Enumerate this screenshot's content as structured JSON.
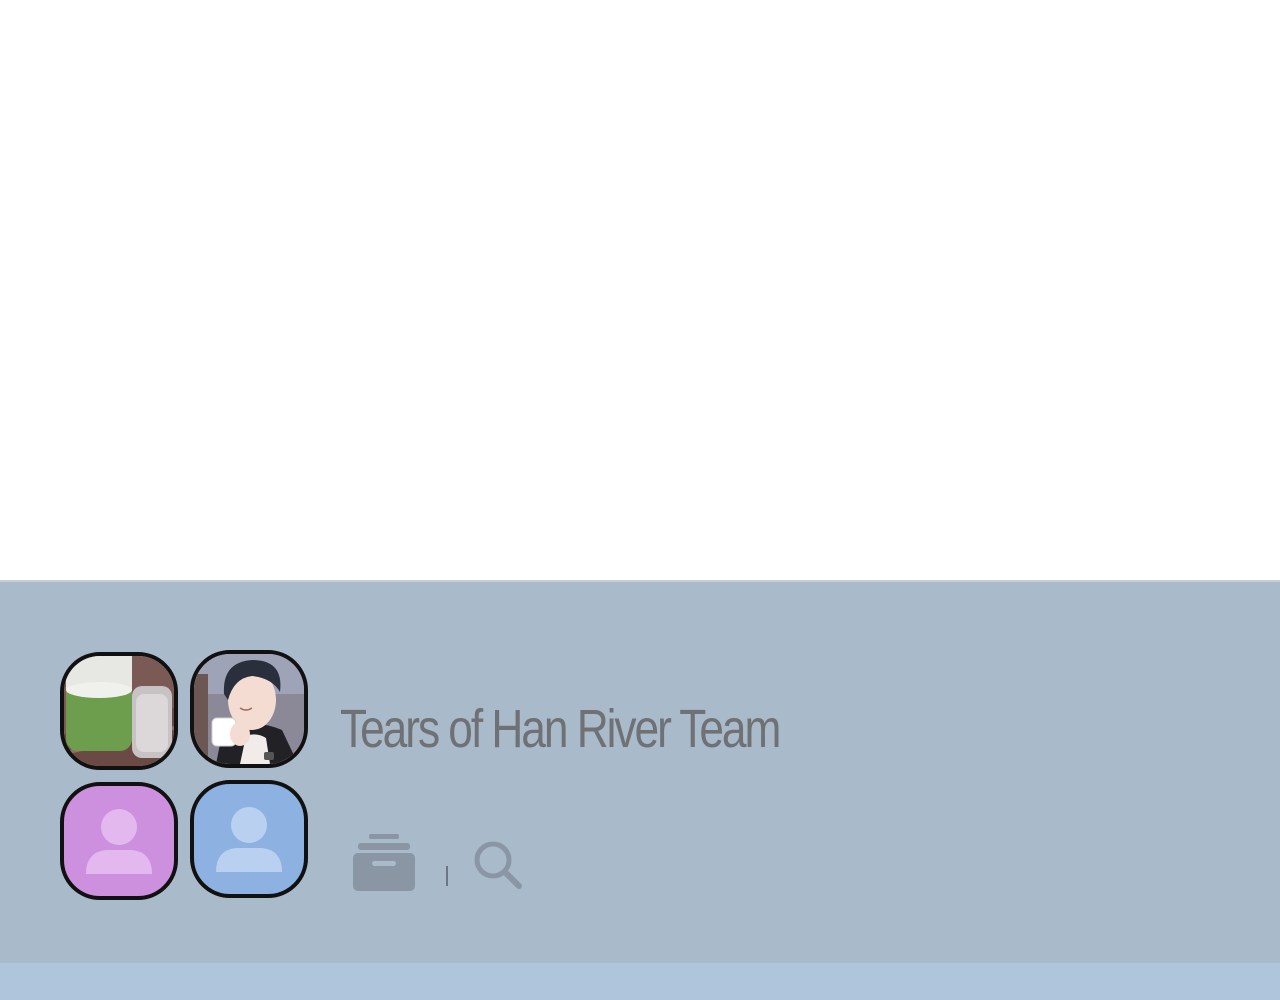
{
  "chat": {
    "title": "Tears of Han River Team"
  },
  "avatars": [
    {
      "kind": "photo",
      "subject": "drinks-on-table"
    },
    {
      "kind": "photo",
      "subject": "man-with-cup"
    },
    {
      "kind": "placeholder",
      "color": "#cd90de"
    },
    {
      "kind": "placeholder",
      "color": "#8db1e0"
    }
  ],
  "actions": [
    {
      "icon": "archive-icon"
    },
    {
      "icon": "search-icon"
    }
  ],
  "colors": {
    "panel": "#a9bacb",
    "strip": "#afc5dc",
    "title": "#6f7174",
    "icon": "#8a96a3"
  }
}
